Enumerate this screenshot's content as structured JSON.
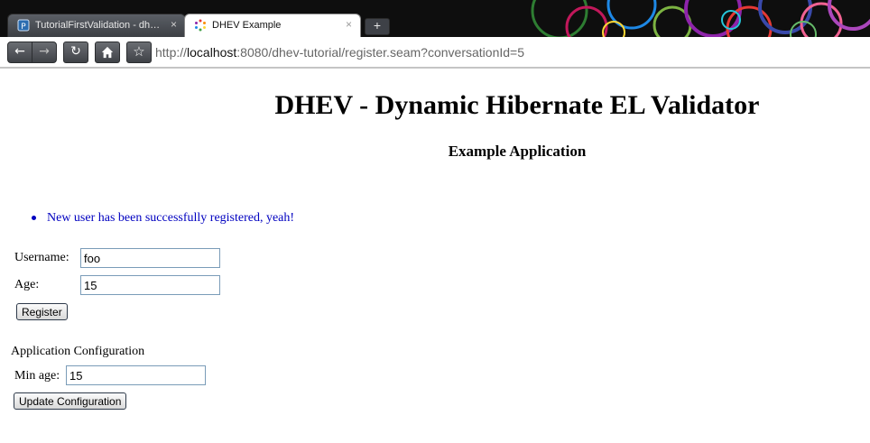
{
  "browser": {
    "tabs": [
      {
        "title": "TutorialFirstValidation - dhe…",
        "active": false,
        "close": "×"
      },
      {
        "title": "DHEV Example",
        "active": true,
        "close": "×"
      }
    ],
    "new_tab_symbol": "+",
    "toolbar": {
      "back_icon": "back-arrow-icon",
      "forward_icon": "forward-arrow-icon",
      "reload_icon": "reload-icon",
      "home_icon": "home-icon",
      "bookmark_icon": "star-icon"
    },
    "url": {
      "scheme": "http://",
      "host": "localhost",
      "rest": ":8080/dhev-tutorial/register.seam?conversationId=5"
    }
  },
  "page": {
    "title": "DHEV - Dynamic Hibernate EL Validator",
    "subtitle": "Example Application",
    "message": "New user has been successfully registered, yeah!",
    "form": {
      "username_label": "Username:",
      "username_value": "foo",
      "age_label": "Age:",
      "age_value": "15",
      "register_button": "Register"
    },
    "config": {
      "heading": "Application Configuration",
      "min_age_label": "Min age:",
      "min_age_value": "15",
      "update_button": "Update Configuration"
    }
  },
  "colors": {
    "message": "#0000c0",
    "input_border": "#7a9cb8"
  }
}
